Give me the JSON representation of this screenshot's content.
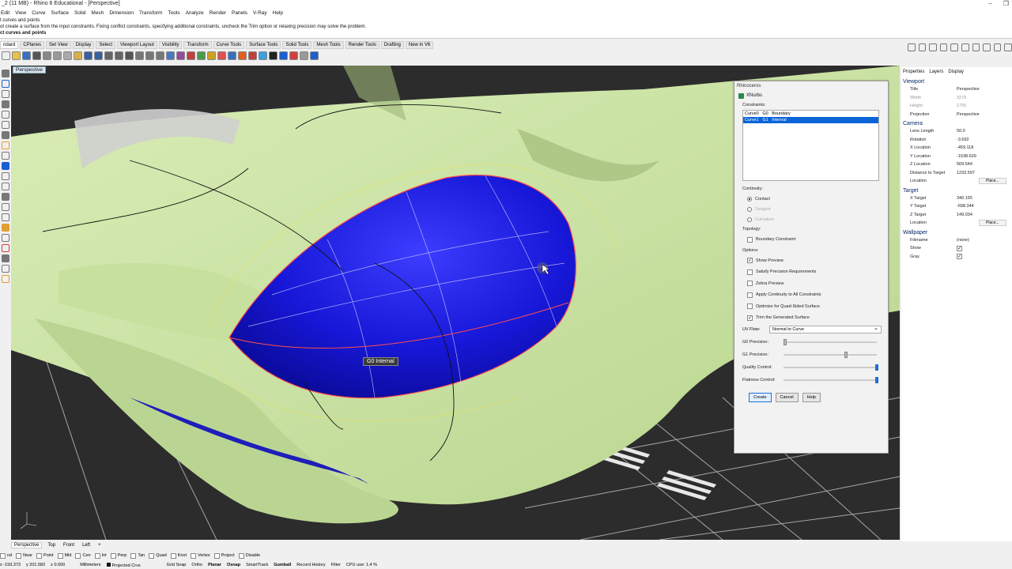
{
  "window": {
    "title": "_2 (11 MB) - Rhino 6 Educational - [Perspective]",
    "controls": [
      "–",
      "❐"
    ]
  },
  "menubar": [
    "Edit",
    "View",
    "Curve",
    "Surface",
    "Solid",
    "Mesh",
    "Dimension",
    "Transform",
    "Tools",
    "Analyze",
    "Render",
    "Panels",
    "V-Ray",
    "Help"
  ],
  "command_history": {
    "line1": "t curves and points",
    "line2": "ot create a surface from the input constraints. Fixing conflict constraints, specifying additional constraints, uncheck the Trim option or relaxing precision may solve the problem.",
    "prompt": "ct curves and points"
  },
  "toolbar_tabs": [
    "ndard",
    "CPlanes",
    "Set View",
    "Display",
    "Select",
    "Viewport Layout",
    "Visibility",
    "Transform",
    "Curve Tools",
    "Surface Tools",
    "Solid Tools",
    "Mesh Tools",
    "Render Tools",
    "Drafting",
    "New in V6"
  ],
  "toolbar_tab_selected": 0,
  "viewport": {
    "title": "Perspective",
    "label_g0": "G0 Internal"
  },
  "colors": {
    "surface_green": "#cfe6a8",
    "patch_blue": "#1a1adf",
    "selection_blue": "#0a64d8",
    "edge_red": "#e03030",
    "iso_yellow": "#e6e06a"
  },
  "right_panel": {
    "tabs": [
      "Properties",
      "Layers",
      "Display"
    ],
    "viewport_section": "Viewport",
    "viewport_rows": [
      {
        "k": "Title",
        "v": "Perspective"
      },
      {
        "k": "Width",
        "v": "3279",
        "dim": true
      },
      {
        "k": "Height",
        "v": "1755",
        "dim": true
      },
      {
        "k": "Projection",
        "v": "Perspective"
      }
    ],
    "camera_section": "Camera",
    "camera_rows": [
      {
        "k": "Lens Length",
        "v": "50.0"
      },
      {
        "k": "Rotation",
        "v": "-3.692"
      },
      {
        "k": "X Location",
        "v": "-459.118"
      },
      {
        "k": "Y Location",
        "v": "-1538.639"
      },
      {
        "k": "Z Location",
        "v": "569.544"
      },
      {
        "k": "Distance to Target",
        "v": "1233.597"
      },
      {
        "k": "Location",
        "v": "Place..."
      }
    ],
    "target_section": "Target",
    "target_rows": [
      {
        "k": "X Target",
        "v": "340.155"
      },
      {
        "k": "Y Target",
        "v": "-698.344"
      },
      {
        "k": "Z Target",
        "v": "149.034"
      },
      {
        "k": "Location",
        "v": "Place..."
      }
    ],
    "wallpaper_section": "Wallpaper",
    "wallpaper_rows": [
      {
        "k": "Filename",
        "v": "(none)"
      },
      {
        "k": "Show",
        "v": "✓"
      },
      {
        "k": "Gray",
        "v": "✓"
      }
    ]
  },
  "dialog": {
    "title": "Rhinoceros",
    "subtitle": "XNurbs",
    "constraints_label": "Constraints:",
    "constraints": [
      "Curve0   G0   Boundary",
      "Curve1   G1   Internal"
    ],
    "constraint_selected": 1,
    "continuity_label": "Continuity:",
    "continuity": [
      {
        "label": "Contact",
        "on": true,
        "dim": false
      },
      {
        "label": "Tangent",
        "on": false,
        "dim": true
      },
      {
        "label": "Curvature",
        "on": false,
        "dim": true
      }
    ],
    "topology_label": "Topology:",
    "topology_options": [
      {
        "label": "Boundary Constraint",
        "checked": false
      }
    ],
    "options_label": "Options:",
    "options": [
      {
        "label": "Show Preview",
        "checked": true
      },
      {
        "label": "Satisfy Precision Requirements",
        "checked": false
      },
      {
        "label": "Zebra Preview",
        "checked": false
      },
      {
        "label": "Apply Continuity to All Constraints",
        "checked": false
      },
      {
        "label": "Optimize for Quad-Sided Surface",
        "checked": false
      },
      {
        "label": "Trim the Generated Surface",
        "checked": true
      }
    ],
    "uv_flow_label": "UV Flow:",
    "uv_flow_value": "Normal to Curve",
    "sliders": [
      {
        "label": "G0 Precision:",
        "value": 0.02,
        "blue": false
      },
      {
        "label": "G1 Precision:",
        "value": 0.67,
        "blue": false
      },
      {
        "label": "Quality Control:",
        "value": 1.0,
        "blue": true
      },
      {
        "label": "Flatness Control:",
        "value": 1.0,
        "blue": true
      }
    ],
    "buttons": [
      "Create",
      "Cancel",
      "Help"
    ]
  },
  "viewport_tabs": [
    "Perspective",
    "Top",
    "Front",
    "Left",
    "+"
  ],
  "viewport_tab_selected": 0,
  "osnaps": [
    {
      "label": "nd",
      "checked": false
    },
    {
      "label": "Near",
      "checked": false
    },
    {
      "label": "Point",
      "checked": false
    },
    {
      "label": "Mid",
      "checked": false
    },
    {
      "label": "Cen",
      "checked": false
    },
    {
      "label": "Int",
      "checked": false
    },
    {
      "label": "Perp",
      "checked": false
    },
    {
      "label": "Tan",
      "checked": false
    },
    {
      "label": "Quad",
      "checked": false
    },
    {
      "label": "Knot",
      "checked": false
    },
    {
      "label": "Vertex",
      "checked": false
    },
    {
      "label": "Project",
      "checked": false
    },
    {
      "label": "Disable",
      "checked": false
    }
  ],
  "status": {
    "x": "x -193.373",
    "y": "y 201.582",
    "z": "z 0.000",
    "units": "Millimeters",
    "layer": "Projected Crvs",
    "grid_snap": "Grid Snap",
    "ortho": "Ortho",
    "planar": "Planar",
    "osnap": "Osnap",
    "smarttrack": "SmartTrack",
    "gumball": "Gumball",
    "record_history": "Record History",
    "filter": "Filter",
    "cpu": "CPU use: 1.4 %"
  }
}
